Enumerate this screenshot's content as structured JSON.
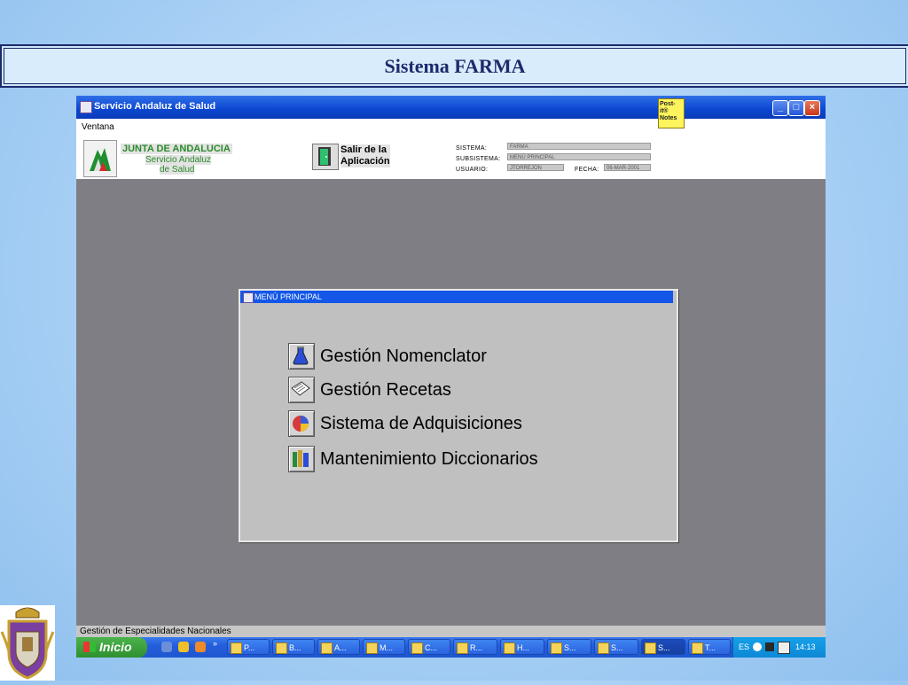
{
  "slide": {
    "title": "Sistema FARMA"
  },
  "window": {
    "title": "Servicio Andaluz de Salud",
    "menu": "Ventana",
    "postit": "Post-it® Notes",
    "controls": {
      "minimize": "_",
      "maximize": "□",
      "close": "×"
    }
  },
  "header": {
    "junta": "JUNTA DE ANDALUCIA",
    "sas_line1": "Servicio Andaluz",
    "sas_line2": "de Salud",
    "exit_line1": "Salir de la",
    "exit_line2": "Aplicación",
    "sistema_label": "SISTEMA:",
    "sistema_value": "FARMA",
    "subsistema_label": "SUBSISTEMA:",
    "subsistema_value": "MENÚ PRINCIPAL",
    "usuario_label": "USUARIO:",
    "usuario_value": "JTORREJON",
    "fecha_label": "FECHA:",
    "fecha_value": "06-MAR-2001"
  },
  "dialog": {
    "title": "MENÚ PRINCIPAL",
    "items": [
      {
        "label": "Gestión Nomenclator",
        "icon": "flask-icon"
      },
      {
        "label": "Gestión Recetas",
        "icon": "prescription-icon"
      },
      {
        "label": "Sistema de Adquisiciones",
        "icon": "pie-chart-icon"
      },
      {
        "label": "Mantenimiento Diccionarios",
        "icon": "books-icon"
      }
    ]
  },
  "statusbar": {
    "text": "Gestión de Especialidades Nacionales"
  },
  "taskbar": {
    "start": "Inicio",
    "chevron": "»",
    "tasks": [
      "P...",
      "B...",
      "A...",
      "M...",
      "C...",
      "R...",
      "H...",
      "S...",
      "S...",
      "S...",
      "T..."
    ],
    "lang": "ES",
    "clock": "14:13"
  }
}
